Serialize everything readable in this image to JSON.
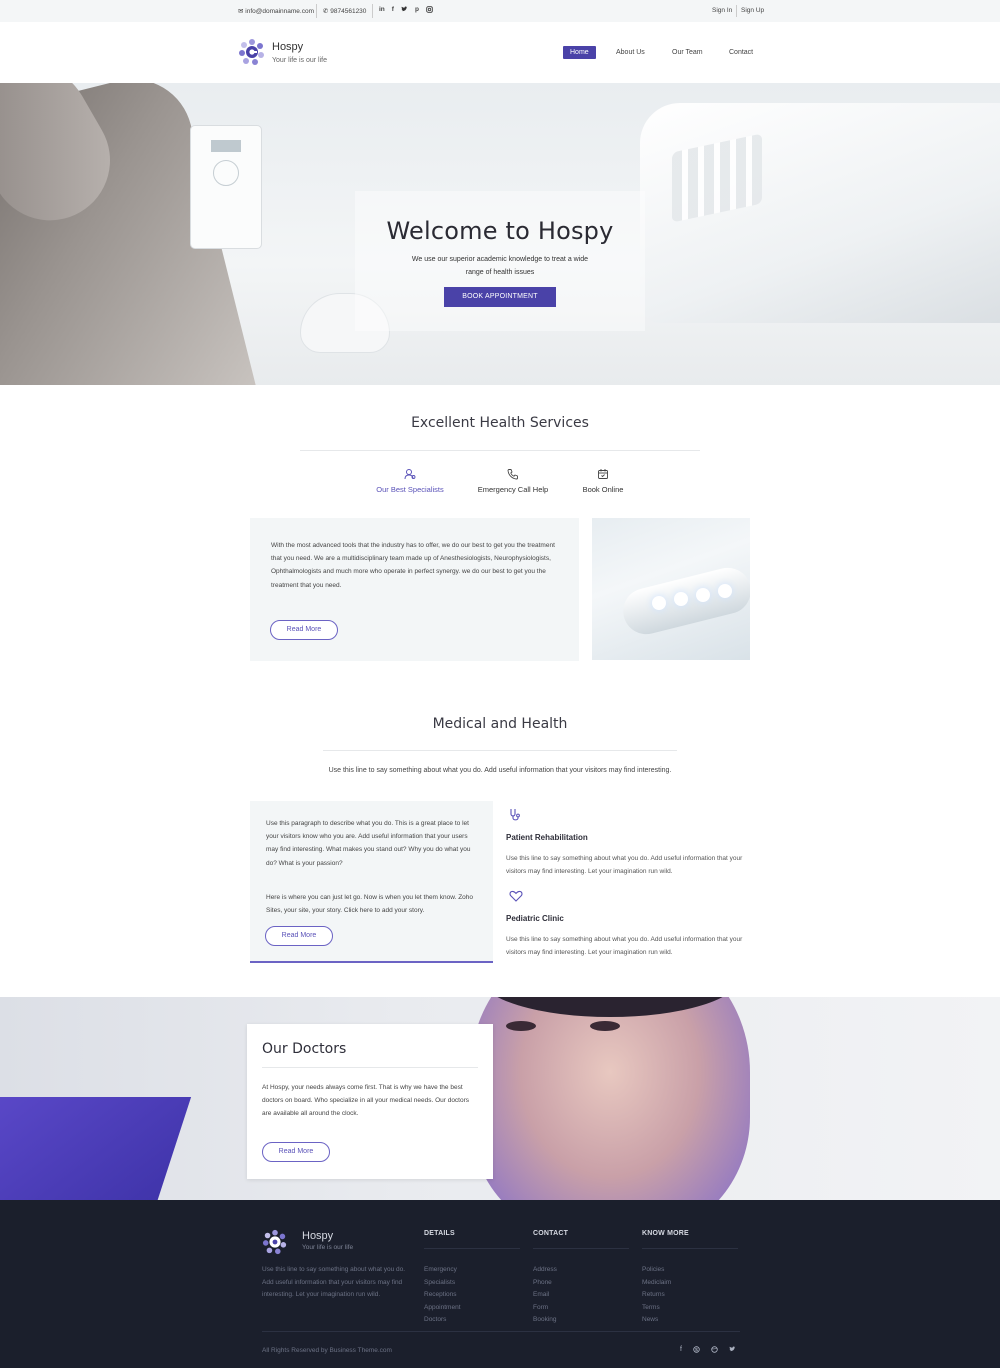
{
  "topbar": {
    "email": "info@domainname.com",
    "phone": "9874561230",
    "socials": [
      "in",
      "f",
      "t",
      "p",
      "ig"
    ],
    "sign_in": "Sign In",
    "sign_up": "Sign Up"
  },
  "header": {
    "brand": "Hospy",
    "tagline": "Your life is our life",
    "nav": [
      "Home",
      "About Us",
      "Our Team",
      "Contact"
    ],
    "active_nav": "Home"
  },
  "hero": {
    "title": "Welcome to Hospy",
    "subtitle": "We use our superior academic knowledge to treat a wide range of health issues",
    "button": "BOOK APPOINTMENT"
  },
  "services": {
    "title": "Excellent Health Services",
    "tabs": [
      {
        "label": "Our Best Specialists",
        "icon": "specialist-icon"
      },
      {
        "label": "Emergency Call Help",
        "icon": "phone-icon"
      },
      {
        "label": "Book Online",
        "icon": "calendar-icon"
      }
    ],
    "body": "With the most advanced tools that the industry has to offer, we do our best to get you the treatment that you need. We are a multidisciplinary team made up of Anesthesiologists, Neurophysiologists, Ophthalmologists and much more who operate in perfect synergy. we do our best to get you the treatment that you need.",
    "button": "Read More"
  },
  "medical": {
    "title": "Medical and Health",
    "subtitle": "Use this line to say something about what you do. Add useful information that your visitors may find interesting.",
    "para1": "Use this paragraph to describe what you do. This is a great place to let your visitors know who you are. Add useful information that your users may find interesting. What makes you stand out? Why you do what you do? What is your passion?",
    "para2": "Here is where you can just let go. Now is when you let them know. Zoho Sites, your site, your story. Click here to add your story.",
    "button": "Read More",
    "features": [
      {
        "title": "Patient Rehabilitation",
        "desc": "Use this line to say something about what you do. Add useful information that your visitors may find interesting. Let your imagination run wild.",
        "icon": "stethoscope-icon"
      },
      {
        "title": "Pediatric Clinic",
        "desc": "Use this line to say something about what you do. Add useful information that your visitors may find interesting. Let your imagination run wild.",
        "icon": "heart-icon"
      }
    ]
  },
  "doctors": {
    "title": "Our Doctors",
    "body": "At Hospy, your needs always come first. That is why we have the best doctors on board. Who specialize in all your medical needs. Our doctors are available all around the clock.",
    "button": "Read More"
  },
  "footer": {
    "brand": "Hospy",
    "tagline": "Your life is our life",
    "desc": "Use this line to say something about what you do. Add useful information that your visitors may find interesting. Let your imagination run wild.",
    "columns": [
      {
        "heading": "DETAILS",
        "items": [
          "Emergency",
          "Specialists",
          "Receptions",
          "Appointment",
          "Doctors"
        ]
      },
      {
        "heading": "CONTACT",
        "items": [
          "Address",
          "Phone",
          "Email",
          "Form",
          "Booking"
        ]
      },
      {
        "heading": "KNOW MORE",
        "items": [
          "Policies",
          "Mediclaim",
          "Returns",
          "Terms",
          "News"
        ]
      }
    ],
    "copyright": "All Rights Reserved by Business Theme.com",
    "socials": [
      "f",
      "s",
      "d",
      "t"
    ]
  },
  "colors": {
    "accent": "#4a42a8",
    "footer_bg": "#1b1f2c",
    "panel_bg": "#f3f6f7"
  }
}
